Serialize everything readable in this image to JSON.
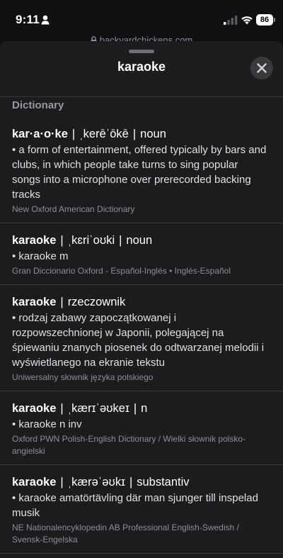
{
  "status_bar": {
    "time": "9:11",
    "battery": "86"
  },
  "url": "backyardchickens.com",
  "sheet": {
    "title": "karaoke",
    "section_header": "Dictionary"
  },
  "entries": [
    {
      "headword": "kar·a·o·ke",
      "pronunciation": "ˌkerēˈōkē",
      "pos": "noun",
      "definition": "• a form of entertainment, offered typically by bars and clubs, in which people take turns to sing popular songs into a microphone over prerecorded backing tracks",
      "source": "New Oxford American Dictionary"
    },
    {
      "headword": "karaoke",
      "pronunciation": "ˌkɛriˈoʊki",
      "pos": "noun",
      "definition": "• karaoke m",
      "source": "Gran Diccionario Oxford - Español-Inglés • Inglés-Español"
    },
    {
      "headword": "karaoke",
      "pronunciation": "",
      "pos": "rzeczownik",
      "definition": "• rodzaj zabawy zapoczątkowanej i rozpowszechnionej w Japonii, polegającej na śpiewaniu znanych piosenek do odtwarzanej melodii i wyświetlanego na ekranie tekstu",
      "source": "Uniwersalny słownik języka polskiego"
    },
    {
      "headword": "karaoke",
      "pronunciation": "ˌkærɪˈəʊkeɪ",
      "pos": "n",
      "definition": "• karaoke n inv",
      "source": "Oxford PWN Polish-English Dictionary / Wielki słownik polsko-angielski"
    },
    {
      "headword": "karaoke",
      "pronunciation": "ˌkærəˈəʊkɪ",
      "pos": "substantiv",
      "definition": "• karaoke amatörtävling där man sjunger till inspelad musik",
      "source": "NE Nationalencyklopedin AB Professional English-Swedish / Svensk-Engelska"
    }
  ]
}
